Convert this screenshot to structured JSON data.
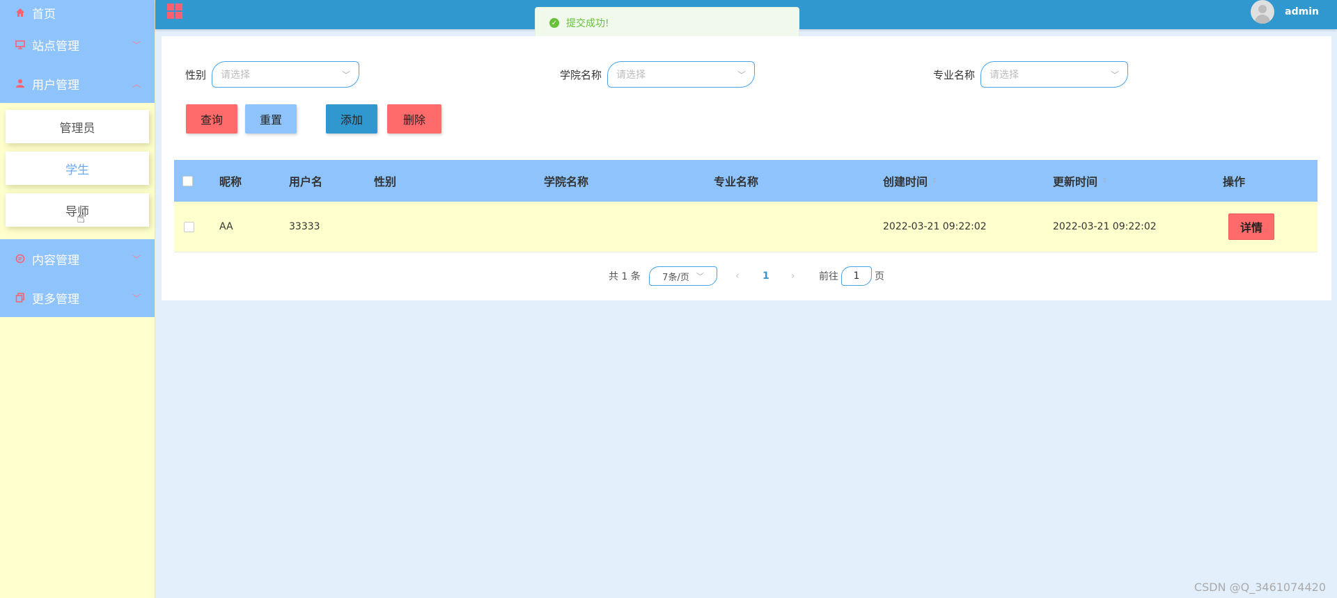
{
  "sidebar": {
    "items": [
      {
        "label": "首页"
      },
      {
        "label": "站点管理"
      },
      {
        "label": "用户管理"
      },
      {
        "label": "内容管理"
      },
      {
        "label": "更多管理"
      }
    ],
    "sub_items": [
      {
        "label": "管理员"
      },
      {
        "label": "学生"
      },
      {
        "label": "导师"
      }
    ]
  },
  "topbar": {
    "admin": "admin"
  },
  "toast": {
    "message": "提交成功!"
  },
  "filters": {
    "gender": {
      "label": "性别",
      "placeholder": "请选择"
    },
    "college": {
      "label": "学院名称",
      "placeholder": "请选择"
    },
    "major": {
      "label": "专业名称",
      "placeholder": "请选择"
    }
  },
  "buttons": {
    "query": "查询",
    "reset": "重置",
    "add": "添加",
    "delete": "删除"
  },
  "table": {
    "headers": [
      "昵称",
      "用户名",
      "性别",
      "学院名称",
      "专业名称",
      "创建时间",
      "更新时间",
      "操作"
    ],
    "rows": [
      {
        "nickname": "AA",
        "username": "33333",
        "gender": "",
        "college": "",
        "major": "",
        "created": "2022-03-21 09:22:02",
        "updated": "2022-03-21 09:22:02",
        "action": "详情"
      }
    ]
  },
  "pagination": {
    "total": "共 1 条",
    "page_size": "7条/页",
    "current_page": "1",
    "goto_label": "前往",
    "goto_value": "1",
    "page_suffix": "页"
  },
  "watermark": "CSDN @Q_3461074420",
  "colors": {
    "sidebar_bg": "#ffffcd",
    "menu_bg": "#8ec4fb",
    "topbar_bg": "#3097cf",
    "accent_red": "#ff6a6a",
    "success_green": "#67c23a"
  }
}
